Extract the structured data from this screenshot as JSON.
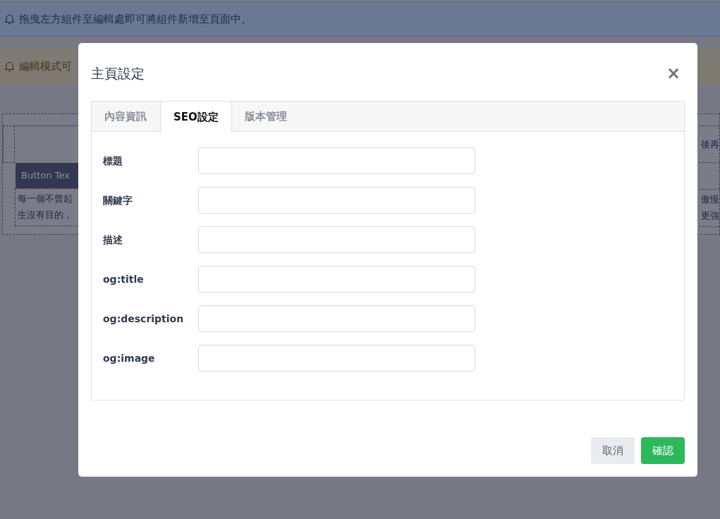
{
  "page": {
    "alerts": [
      {
        "kind": "info",
        "text": "拖曳左方組件至編輯處即可將組件新增至頁面中。"
      },
      {
        "kind": "warning",
        "text": "編輯模式可"
      }
    ],
    "canvas": {
      "button_label": "Button Tex",
      "left_lines": [
        "每一個不曾起",
        "生沒有目的，"
      ],
      "right_texts": [
        "後再",
        "傲慢",
        "更強"
      ]
    }
  },
  "modal": {
    "title": "主頁設定",
    "close": "×",
    "tabs": [
      {
        "label": "內容資訊",
        "selected": false
      },
      {
        "label": "SEO設定",
        "selected": true
      },
      {
        "label": "版本管理",
        "selected": false
      }
    ],
    "fields": [
      {
        "label": "標題"
      },
      {
        "label": "關鍵字"
      },
      {
        "label": "描述"
      },
      {
        "label": "og:title"
      },
      {
        "label": "og:description"
      },
      {
        "label": "og:image"
      }
    ],
    "buttons": [
      {
        "label": "取消",
        "kind": "secondary"
      },
      {
        "label": "確認",
        "kind": "primary"
      }
    ]
  }
}
